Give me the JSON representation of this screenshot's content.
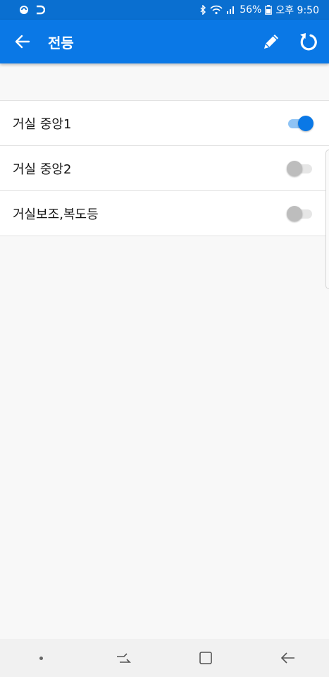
{
  "status_bar": {
    "left_icons": [
      "notification-app-icon",
      "refresh-app-icon"
    ],
    "battery": "56%",
    "time": "오후 9:50",
    "right_icons": [
      "bluetooth-icon",
      "wifi-icon",
      "signal-icon",
      "battery-icon"
    ]
  },
  "app_bar": {
    "title": "전등",
    "color": "#0a78e6"
  },
  "lights": [
    {
      "label": "거실 중앙1",
      "on": true
    },
    {
      "label": "거실 중앙2",
      "on": false
    },
    {
      "label": "거실보조,복도등",
      "on": false
    }
  ],
  "accent_color": "#0a78e6",
  "nav_bar": {
    "icons": [
      "dot-icon",
      "recent-apps-icon",
      "home-icon",
      "back-icon"
    ]
  }
}
